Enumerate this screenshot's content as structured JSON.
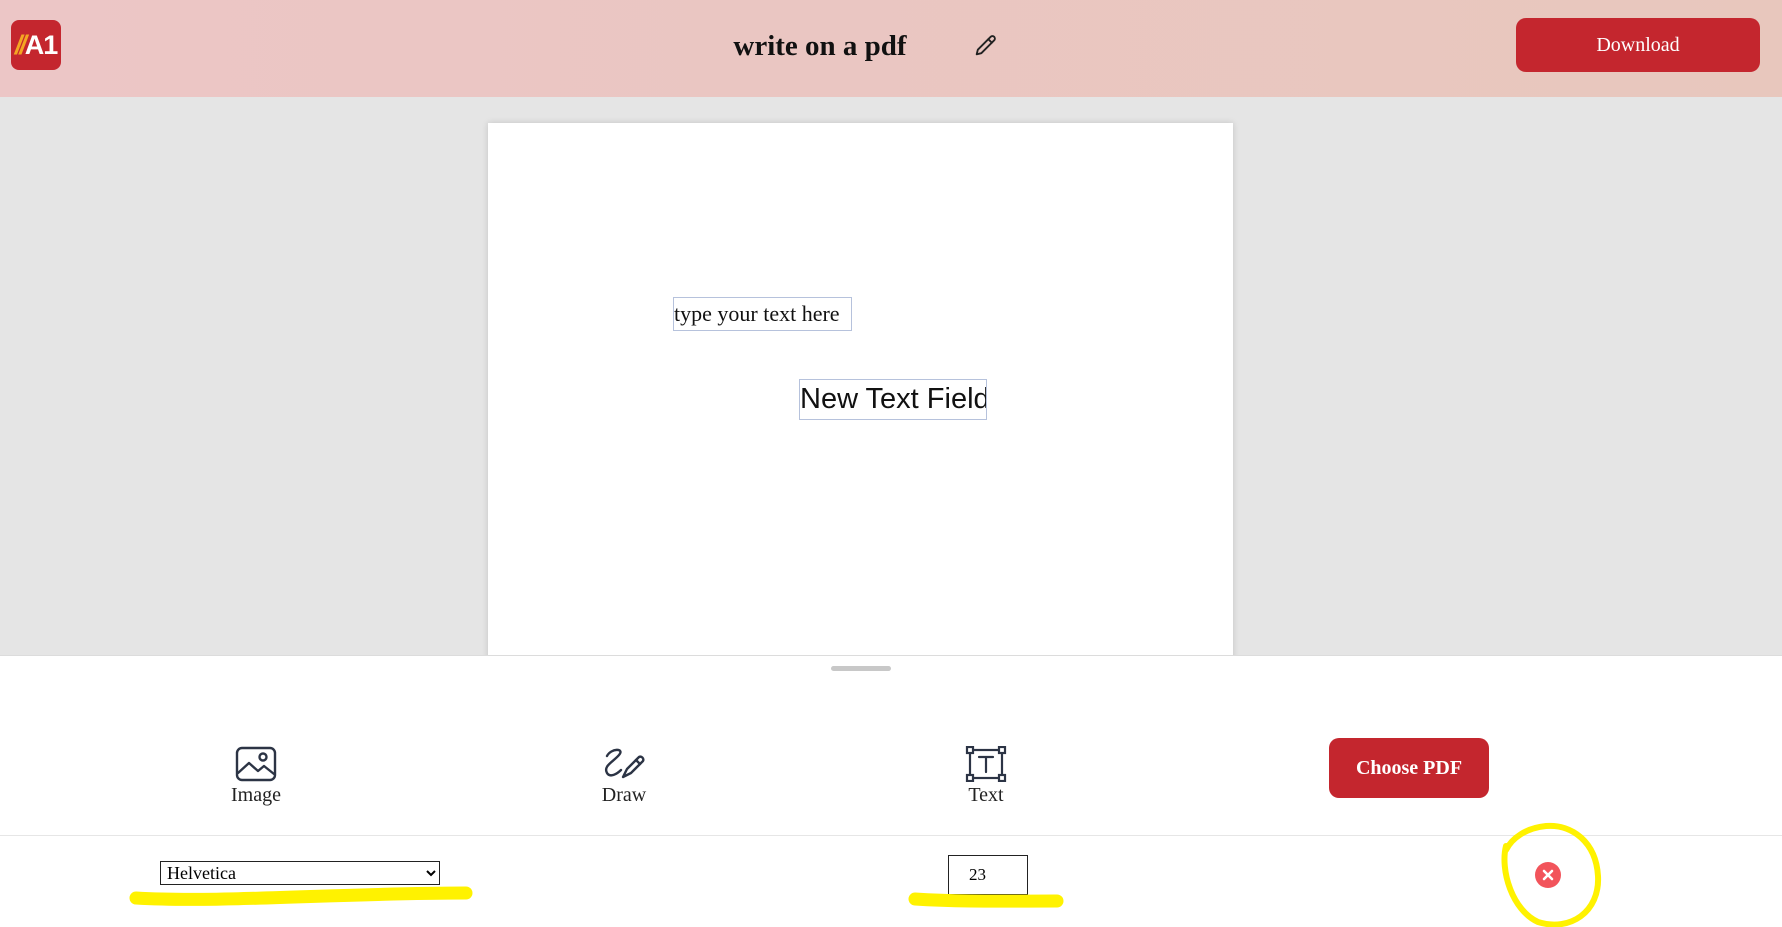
{
  "header": {
    "logo_text": "A1",
    "logo_slashes": "//",
    "title": "write on a pdf",
    "edit_icon": "pencil-icon",
    "download_label": "Download"
  },
  "canvas": {
    "text_fields": [
      {
        "value": "type your text here",
        "font": "serif"
      },
      {
        "value": "New Text Field",
        "font": "sans-serif"
      }
    ]
  },
  "tools": {
    "image_label": "Image",
    "image_icon": "image-icon",
    "draw_label": "Draw",
    "draw_icon": "draw-icon",
    "text_label": "Text",
    "text_icon": "text-box-icon",
    "choose_pdf_label": "Choose PDF"
  },
  "text_options": {
    "font_family_selected": "Helvetica",
    "font_size": "23",
    "close_icon": "close-circle-icon"
  },
  "colors": {
    "brand_red": "#c4262e",
    "header_bg": "#ecc6c6",
    "workspace_bg": "#e5e5e5",
    "close_red": "#f2545b",
    "highlight_yellow": "#fff200"
  }
}
